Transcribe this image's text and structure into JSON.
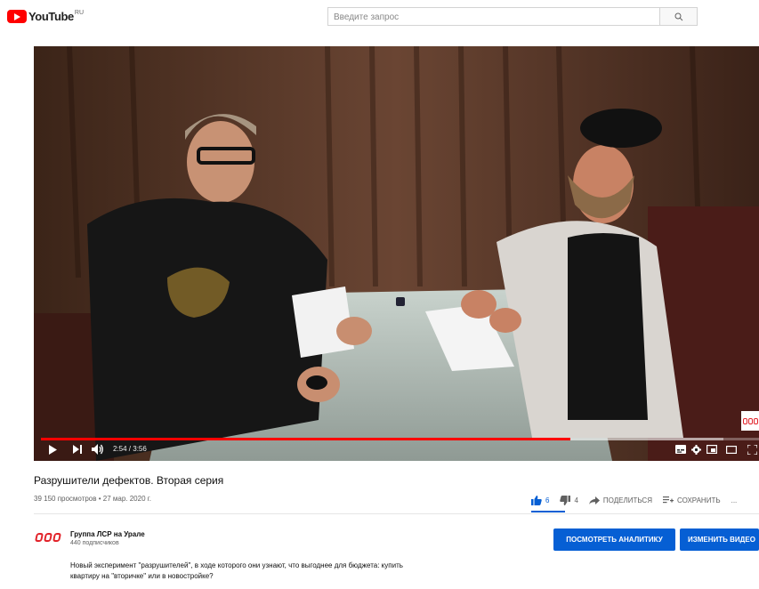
{
  "header": {
    "logo_text": "YouTube",
    "logo_region": "RU",
    "search_placeholder": "Введите запрос"
  },
  "player": {
    "time_current": "2:54",
    "time_separator": " / ",
    "time_total": "3:56",
    "progress_played": 0.737,
    "progress_buffered": 0.95
  },
  "video": {
    "title": "Разрушители дефектов. Вторая серия",
    "views": "39 150 просмотров",
    "dot": " • ",
    "date": "27 мар. 2020 г."
  },
  "actions": {
    "likes": "6",
    "dislikes": "4",
    "share_label": "ПОДЕЛИТЬСЯ",
    "save_label": "СОХРАНИТЬ",
    "more_label": "..."
  },
  "channel": {
    "name": "Группа ЛСР на Урале",
    "subscribers": "440 подписчиков",
    "analytics_button": "ПОСМОТРЕТЬ АНАЛИТИКУ",
    "edit_button": "ИЗМЕНИТЬ ВИДЕО"
  },
  "description": "Новый эксперимент \"разрушителей\", в ходе которого они узнают, что выгоднее для бюджета: купить квартиру на \"вторичке\" или в новостройке?",
  "colors": {
    "brand": "#ff0000",
    "accent": "#065fd4",
    "lsr_red": "#e2232a"
  }
}
